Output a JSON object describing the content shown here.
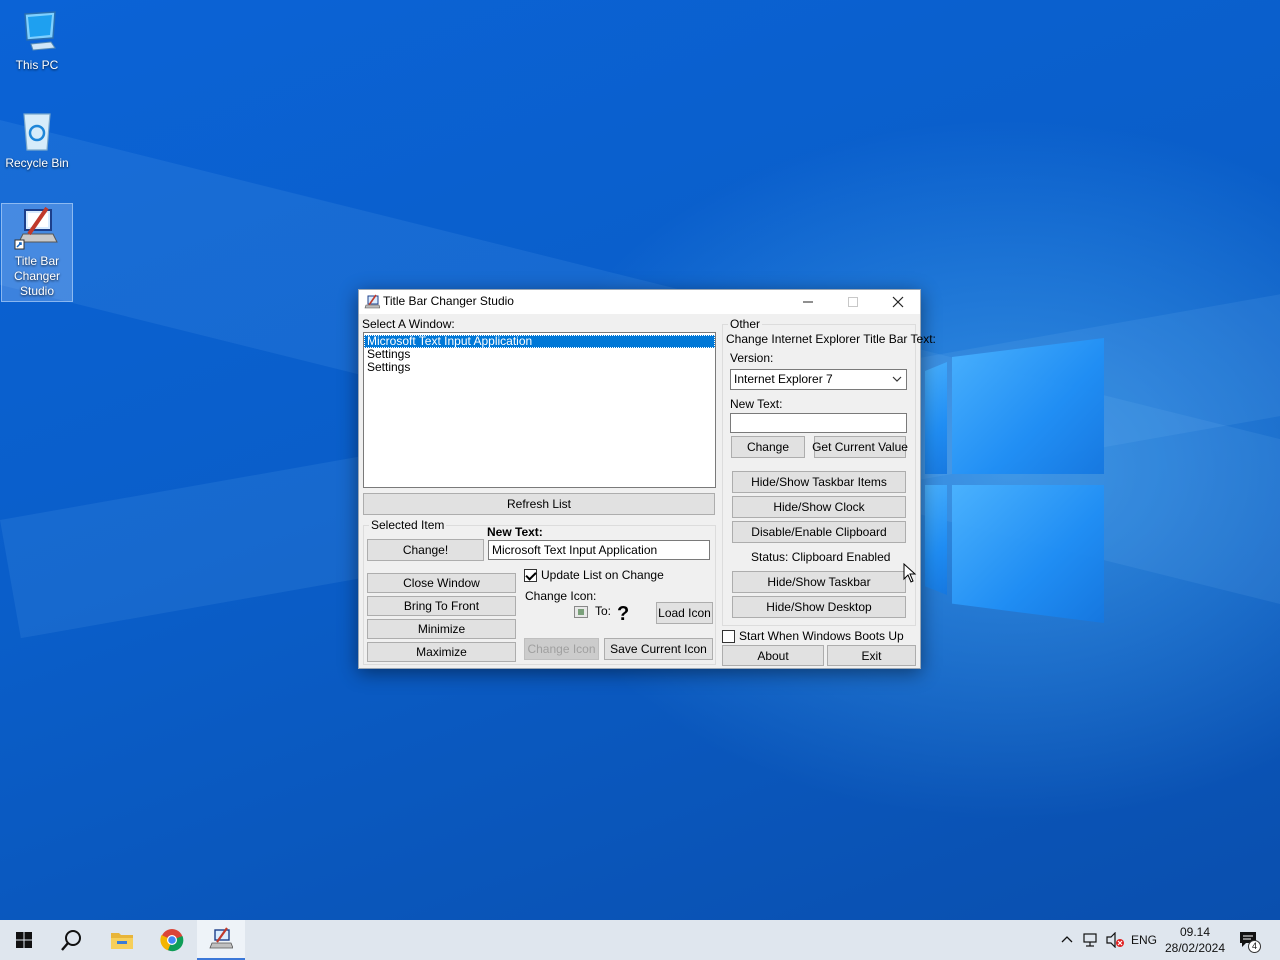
{
  "desktop": {
    "icons": [
      {
        "label": "This PC"
      },
      {
        "label": "Recycle Bin"
      },
      {
        "label": "Title Bar Changer Studio"
      }
    ]
  },
  "window": {
    "title": "Title Bar Changer Studio",
    "select_label": "Select A Window:",
    "window_list": [
      "Microsoft Text Input Application",
      "Settings",
      "Settings"
    ],
    "refresh_label": "Refresh List",
    "selected_item_label": "Selected Item",
    "new_text_label": "New Text:",
    "change_label": "Change!",
    "new_text_value": "Microsoft Text Input Application",
    "close_window_label": "Close Window",
    "bring_front_label": "Bring To Front",
    "minimize_label": "Minimize",
    "maximize_label": "Maximize",
    "update_list_label": "Update List on Change",
    "update_list_checked": true,
    "change_icon_label": "Change Icon:",
    "to_label": "To:",
    "question_mark": "?",
    "load_icon_label": "Load Icon",
    "change_icon_button": "Change Icon",
    "save_icon_button": "Save Current Icon",
    "other_label": "Other",
    "ie_label": "Change Internet Explorer Title Bar Text:",
    "version_label": "Version:",
    "version_value": "Internet Explorer 7",
    "ie_new_text_label": "New Text:",
    "ie_new_text_value": "",
    "ie_change_label": "Change",
    "get_value_label": "Get Current Value",
    "hide_taskbar_items_label": "Hide/Show Taskbar Items",
    "hide_clock_label": "Hide/Show Clock",
    "clipboard_label": "Disable/Enable Clipboard",
    "status_text": "Status: Clipboard Enabled",
    "hide_taskbar_label": "Hide/Show Taskbar",
    "hide_desktop_label": "Hide/Show Desktop",
    "start_boot_label": "Start When Windows Boots Up",
    "start_boot_checked": false,
    "about_label": "About",
    "exit_label": "Exit"
  },
  "taskbar": {
    "apps": [
      "start-icon",
      "search-icon",
      "file-explorer-icon",
      "chrome-icon",
      "title-bar-changer-icon"
    ],
    "language": "ENG",
    "time": "09.14",
    "date": "28/02/2024",
    "notification_count": "4"
  }
}
